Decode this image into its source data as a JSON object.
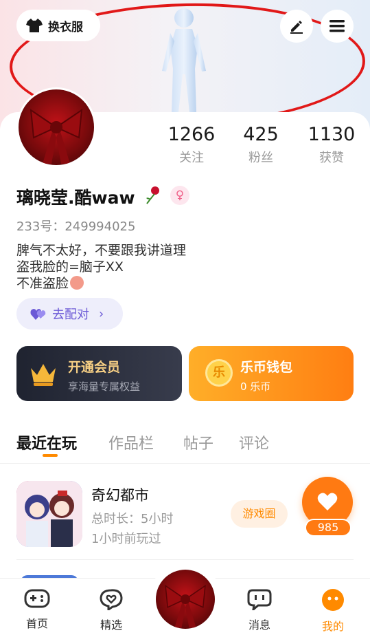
{
  "header": {
    "outfit_label": "换衣服",
    "annotation_color": "#e11818"
  },
  "profile": {
    "stats": [
      {
        "value": "1266",
        "label": "关注"
      },
      {
        "value": "425",
        "label": "粉丝"
      },
      {
        "value": "1130",
        "label": "获赞"
      }
    ],
    "nickname": "璃晓莹.酷waw",
    "gender_symbol": "♀",
    "uid_label": "233号：249994025",
    "bio_lines": [
      "脾气不太好，不要跟我讲道理",
      "盗我脸的=脑子XX",
      "不准盗脸"
    ],
    "match_label": "去配对"
  },
  "cards": {
    "vip": {
      "title": "开通会员",
      "subtitle": "享海量专属权益"
    },
    "wallet": {
      "title": "乐币钱包",
      "subtitle": "0 乐币",
      "coin_glyph": "乐"
    }
  },
  "tabs": [
    "最近在玩",
    "作品栏",
    "帖子",
    "评论"
  ],
  "recent_game": {
    "title": "奇幻都市",
    "duration": "总时长：5小时",
    "last_played": "1小时前玩过",
    "circle_label": "游戏圈",
    "like_count": "985"
  },
  "bottom_nav": [
    {
      "label": "首页",
      "icon": "gamepad-icon"
    },
    {
      "label": "精选",
      "icon": "heart-chat-icon"
    },
    {
      "label": "消息",
      "icon": "message-icon"
    },
    {
      "label": "我的",
      "icon": "profile-face-icon"
    }
  ],
  "colors": {
    "accent": "#ff8a00",
    "purple": "#6b59d6",
    "vip_bg": "#1f2330",
    "wallet_bg": "#ff7e12"
  }
}
